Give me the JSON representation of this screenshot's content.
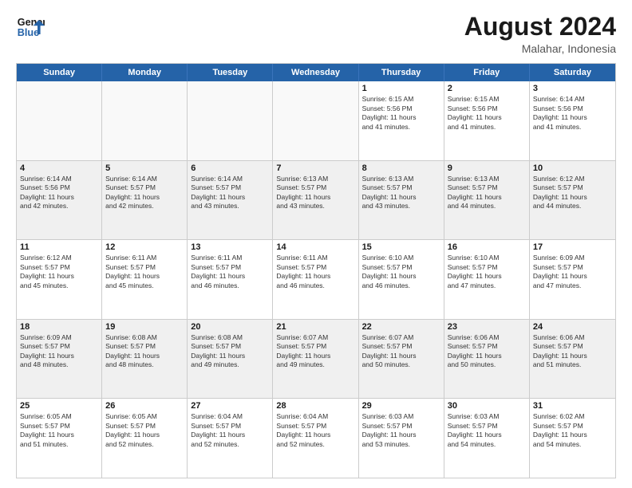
{
  "header": {
    "logo_general": "General",
    "logo_blue": "Blue",
    "month_year": "August 2024",
    "location": "Malahar, Indonesia"
  },
  "weekdays": [
    "Sunday",
    "Monday",
    "Tuesday",
    "Wednesday",
    "Thursday",
    "Friday",
    "Saturday"
  ],
  "rows": [
    {
      "alt": false,
      "cells": [
        {
          "day": "",
          "empty": true,
          "text": ""
        },
        {
          "day": "",
          "empty": true,
          "text": ""
        },
        {
          "day": "",
          "empty": true,
          "text": ""
        },
        {
          "day": "",
          "empty": true,
          "text": ""
        },
        {
          "day": "1",
          "empty": false,
          "text": "Sunrise: 6:15 AM\nSunset: 5:56 PM\nDaylight: 11 hours\nand 41 minutes."
        },
        {
          "day": "2",
          "empty": false,
          "text": "Sunrise: 6:15 AM\nSunset: 5:56 PM\nDaylight: 11 hours\nand 41 minutes."
        },
        {
          "day": "3",
          "empty": false,
          "text": "Sunrise: 6:14 AM\nSunset: 5:56 PM\nDaylight: 11 hours\nand 41 minutes."
        }
      ]
    },
    {
      "alt": true,
      "cells": [
        {
          "day": "4",
          "empty": false,
          "text": "Sunrise: 6:14 AM\nSunset: 5:56 PM\nDaylight: 11 hours\nand 42 minutes."
        },
        {
          "day": "5",
          "empty": false,
          "text": "Sunrise: 6:14 AM\nSunset: 5:57 PM\nDaylight: 11 hours\nand 42 minutes."
        },
        {
          "day": "6",
          "empty": false,
          "text": "Sunrise: 6:14 AM\nSunset: 5:57 PM\nDaylight: 11 hours\nand 43 minutes."
        },
        {
          "day": "7",
          "empty": false,
          "text": "Sunrise: 6:13 AM\nSunset: 5:57 PM\nDaylight: 11 hours\nand 43 minutes."
        },
        {
          "day": "8",
          "empty": false,
          "text": "Sunrise: 6:13 AM\nSunset: 5:57 PM\nDaylight: 11 hours\nand 43 minutes."
        },
        {
          "day": "9",
          "empty": false,
          "text": "Sunrise: 6:13 AM\nSunset: 5:57 PM\nDaylight: 11 hours\nand 44 minutes."
        },
        {
          "day": "10",
          "empty": false,
          "text": "Sunrise: 6:12 AM\nSunset: 5:57 PM\nDaylight: 11 hours\nand 44 minutes."
        }
      ]
    },
    {
      "alt": false,
      "cells": [
        {
          "day": "11",
          "empty": false,
          "text": "Sunrise: 6:12 AM\nSunset: 5:57 PM\nDaylight: 11 hours\nand 45 minutes."
        },
        {
          "day": "12",
          "empty": false,
          "text": "Sunrise: 6:11 AM\nSunset: 5:57 PM\nDaylight: 11 hours\nand 45 minutes."
        },
        {
          "day": "13",
          "empty": false,
          "text": "Sunrise: 6:11 AM\nSunset: 5:57 PM\nDaylight: 11 hours\nand 46 minutes."
        },
        {
          "day": "14",
          "empty": false,
          "text": "Sunrise: 6:11 AM\nSunset: 5:57 PM\nDaylight: 11 hours\nand 46 minutes."
        },
        {
          "day": "15",
          "empty": false,
          "text": "Sunrise: 6:10 AM\nSunset: 5:57 PM\nDaylight: 11 hours\nand 46 minutes."
        },
        {
          "day": "16",
          "empty": false,
          "text": "Sunrise: 6:10 AM\nSunset: 5:57 PM\nDaylight: 11 hours\nand 47 minutes."
        },
        {
          "day": "17",
          "empty": false,
          "text": "Sunrise: 6:09 AM\nSunset: 5:57 PM\nDaylight: 11 hours\nand 47 minutes."
        }
      ]
    },
    {
      "alt": true,
      "cells": [
        {
          "day": "18",
          "empty": false,
          "text": "Sunrise: 6:09 AM\nSunset: 5:57 PM\nDaylight: 11 hours\nand 48 minutes."
        },
        {
          "day": "19",
          "empty": false,
          "text": "Sunrise: 6:08 AM\nSunset: 5:57 PM\nDaylight: 11 hours\nand 48 minutes."
        },
        {
          "day": "20",
          "empty": false,
          "text": "Sunrise: 6:08 AM\nSunset: 5:57 PM\nDaylight: 11 hours\nand 49 minutes."
        },
        {
          "day": "21",
          "empty": false,
          "text": "Sunrise: 6:07 AM\nSunset: 5:57 PM\nDaylight: 11 hours\nand 49 minutes."
        },
        {
          "day": "22",
          "empty": false,
          "text": "Sunrise: 6:07 AM\nSunset: 5:57 PM\nDaylight: 11 hours\nand 50 minutes."
        },
        {
          "day": "23",
          "empty": false,
          "text": "Sunrise: 6:06 AM\nSunset: 5:57 PM\nDaylight: 11 hours\nand 50 minutes."
        },
        {
          "day": "24",
          "empty": false,
          "text": "Sunrise: 6:06 AM\nSunset: 5:57 PM\nDaylight: 11 hours\nand 51 minutes."
        }
      ]
    },
    {
      "alt": false,
      "cells": [
        {
          "day": "25",
          "empty": false,
          "text": "Sunrise: 6:05 AM\nSunset: 5:57 PM\nDaylight: 11 hours\nand 51 minutes."
        },
        {
          "day": "26",
          "empty": false,
          "text": "Sunrise: 6:05 AM\nSunset: 5:57 PM\nDaylight: 11 hours\nand 52 minutes."
        },
        {
          "day": "27",
          "empty": false,
          "text": "Sunrise: 6:04 AM\nSunset: 5:57 PM\nDaylight: 11 hours\nand 52 minutes."
        },
        {
          "day": "28",
          "empty": false,
          "text": "Sunrise: 6:04 AM\nSunset: 5:57 PM\nDaylight: 11 hours\nand 52 minutes."
        },
        {
          "day": "29",
          "empty": false,
          "text": "Sunrise: 6:03 AM\nSunset: 5:57 PM\nDaylight: 11 hours\nand 53 minutes."
        },
        {
          "day": "30",
          "empty": false,
          "text": "Sunrise: 6:03 AM\nSunset: 5:57 PM\nDaylight: 11 hours\nand 54 minutes."
        },
        {
          "day": "31",
          "empty": false,
          "text": "Sunrise: 6:02 AM\nSunset: 5:57 PM\nDaylight: 11 hours\nand 54 minutes."
        }
      ]
    }
  ]
}
